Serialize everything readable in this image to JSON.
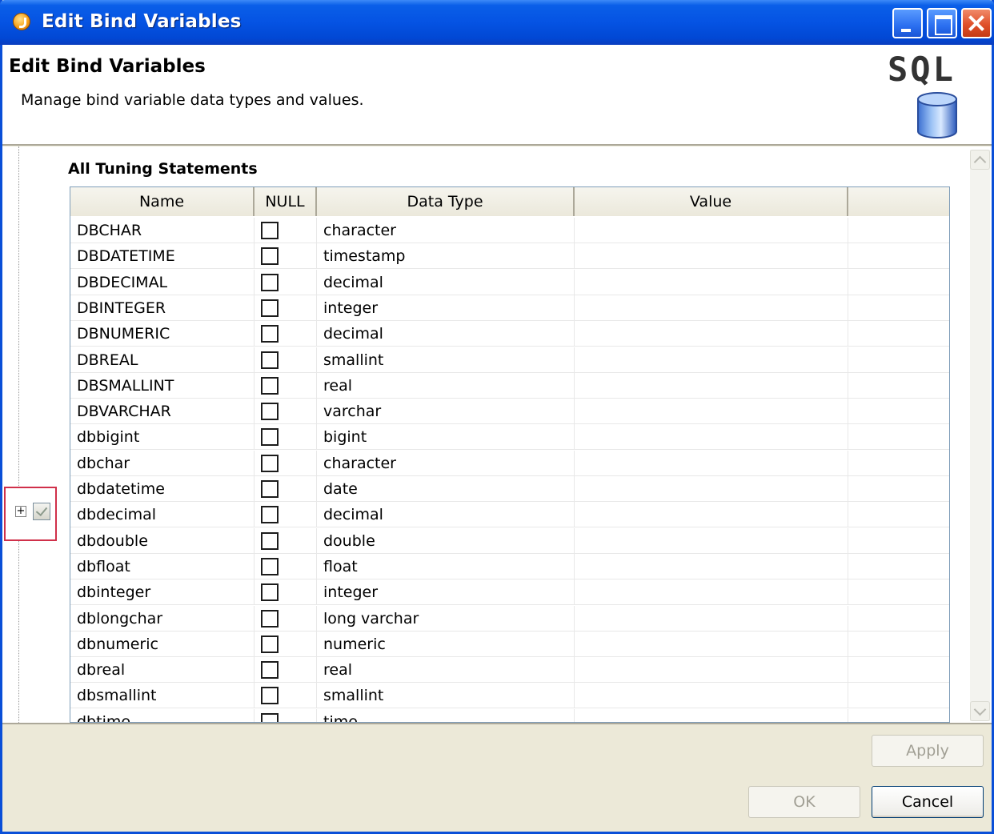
{
  "window": {
    "title": "Edit Bind Variables",
    "icons": {
      "app": "app-icon",
      "minimize": "minimize-icon",
      "maximize": "maximize-icon",
      "close": "close-icon"
    }
  },
  "header": {
    "title": "Edit Bind Variables",
    "description": "Manage bind variable data types and values.",
    "logo_text": "SQL",
    "logo_icon": "database-icon"
  },
  "tree": {
    "expander_text": "+",
    "icons": {
      "node": "checkbox-checked-icon"
    }
  },
  "section": {
    "title": "All Tuning Statements"
  },
  "grid": {
    "columns": [
      "Name",
      "NULL",
      "Data Type",
      "Value"
    ],
    "rows": [
      {
        "name": "DBCHAR",
        "null": false,
        "data_type": "character",
        "value": ""
      },
      {
        "name": "DBDATETIME",
        "null": false,
        "data_type": "timestamp",
        "value": ""
      },
      {
        "name": "DBDECIMAL",
        "null": false,
        "data_type": "decimal",
        "value": ""
      },
      {
        "name": "DBINTEGER",
        "null": false,
        "data_type": "integer",
        "value": ""
      },
      {
        "name": "DBNUMERIC",
        "null": false,
        "data_type": "decimal",
        "value": ""
      },
      {
        "name": "DBREAL",
        "null": false,
        "data_type": "smallint",
        "value": ""
      },
      {
        "name": "DBSMALLINT",
        "null": false,
        "data_type": "real",
        "value": ""
      },
      {
        "name": "DBVARCHAR",
        "null": false,
        "data_type": "varchar",
        "value": ""
      },
      {
        "name": "dbbigint",
        "null": false,
        "data_type": "bigint",
        "value": ""
      },
      {
        "name": "dbchar",
        "null": false,
        "data_type": "character",
        "value": ""
      },
      {
        "name": "dbdatetime",
        "null": false,
        "data_type": "date",
        "value": ""
      },
      {
        "name": "dbdecimal",
        "null": false,
        "data_type": "decimal",
        "value": ""
      },
      {
        "name": "dbdouble",
        "null": false,
        "data_type": "double",
        "value": ""
      },
      {
        "name": "dbfloat",
        "null": false,
        "data_type": "float",
        "value": ""
      },
      {
        "name": "dbinteger",
        "null": false,
        "data_type": "integer",
        "value": ""
      },
      {
        "name": "dblongchar",
        "null": false,
        "data_type": "long varchar",
        "value": ""
      },
      {
        "name": "dbnumeric",
        "null": false,
        "data_type": "numeric",
        "value": ""
      },
      {
        "name": "dbreal",
        "null": false,
        "data_type": "real",
        "value": ""
      },
      {
        "name": "dbsmallint",
        "null": false,
        "data_type": "smallint",
        "value": ""
      },
      {
        "name": "dbtime",
        "null": false,
        "data_type": "time",
        "value": ""
      }
    ]
  },
  "buttons": {
    "apply": "Apply",
    "ok": "OK",
    "cancel": "Cancel"
  },
  "colors": {
    "titlebar": "#0553e3",
    "highlight_border": "#d0304a",
    "face": "#ece9d8"
  }
}
